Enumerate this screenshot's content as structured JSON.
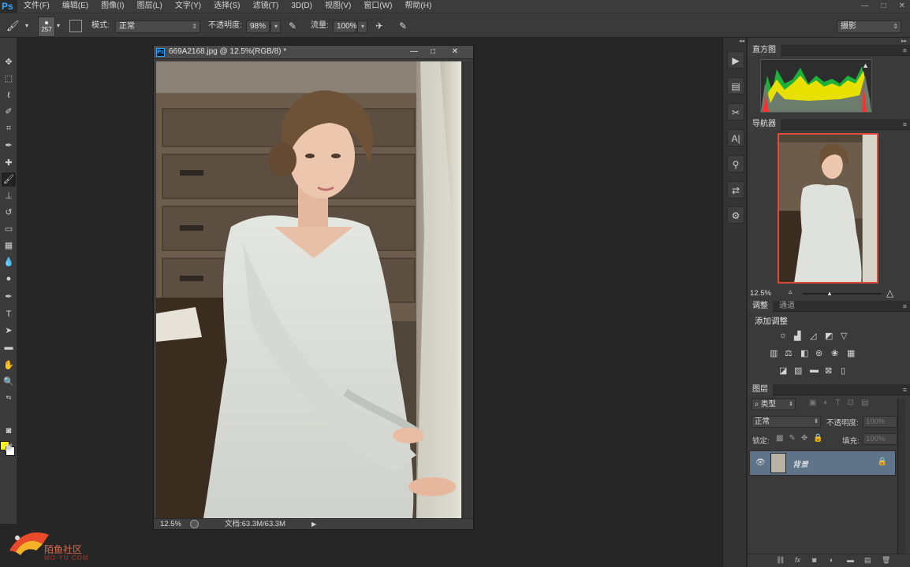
{
  "app": {
    "logo": "Ps"
  },
  "menu": [
    "文件(F)",
    "编辑(E)",
    "图像(I)",
    "图层(L)",
    "文字(Y)",
    "选择(S)",
    "滤镜(T)",
    "3D(D)",
    "视图(V)",
    "窗口(W)",
    "帮助(H)"
  ],
  "window_controls": {
    "minimize": "—",
    "restore": "□",
    "close": "✕"
  },
  "options": {
    "brush_size": "257",
    "mode_label": "模式:",
    "mode_value": "正常",
    "opacity_label": "不透明度:",
    "opacity_value": "98%",
    "flow_label": "流量:",
    "flow_value": "100%",
    "workspace": "摄影"
  },
  "document": {
    "title": "669A2168.jpg @ 12.5%(RGB/8) *",
    "zoom": "12.5%",
    "doc_info": "文档:63.3M/63.3M"
  },
  "panels": {
    "histogram": {
      "tab": "直方图"
    },
    "navigator": {
      "tab": "导航器",
      "zoom": "12.5%"
    },
    "adjustments": {
      "tab": "调整",
      "tab2": "通道",
      "heading": "添加调整"
    },
    "layers": {
      "tab": "图层",
      "filter_kind": "类型",
      "blend_mode": "正常",
      "opacity_label": "不透明度:",
      "opacity_value": "100%",
      "lock_label": "锁定:",
      "fill_label": "填充:",
      "fill_value": "100%",
      "layer_name": "背景"
    }
  },
  "colors": {
    "foreground": "#fff200",
    "background": "#ffffff",
    "selected_layer": "#5f7389"
  },
  "watermark": {
    "text": "陌鱼社区",
    "url": "MO-YU.COM"
  }
}
